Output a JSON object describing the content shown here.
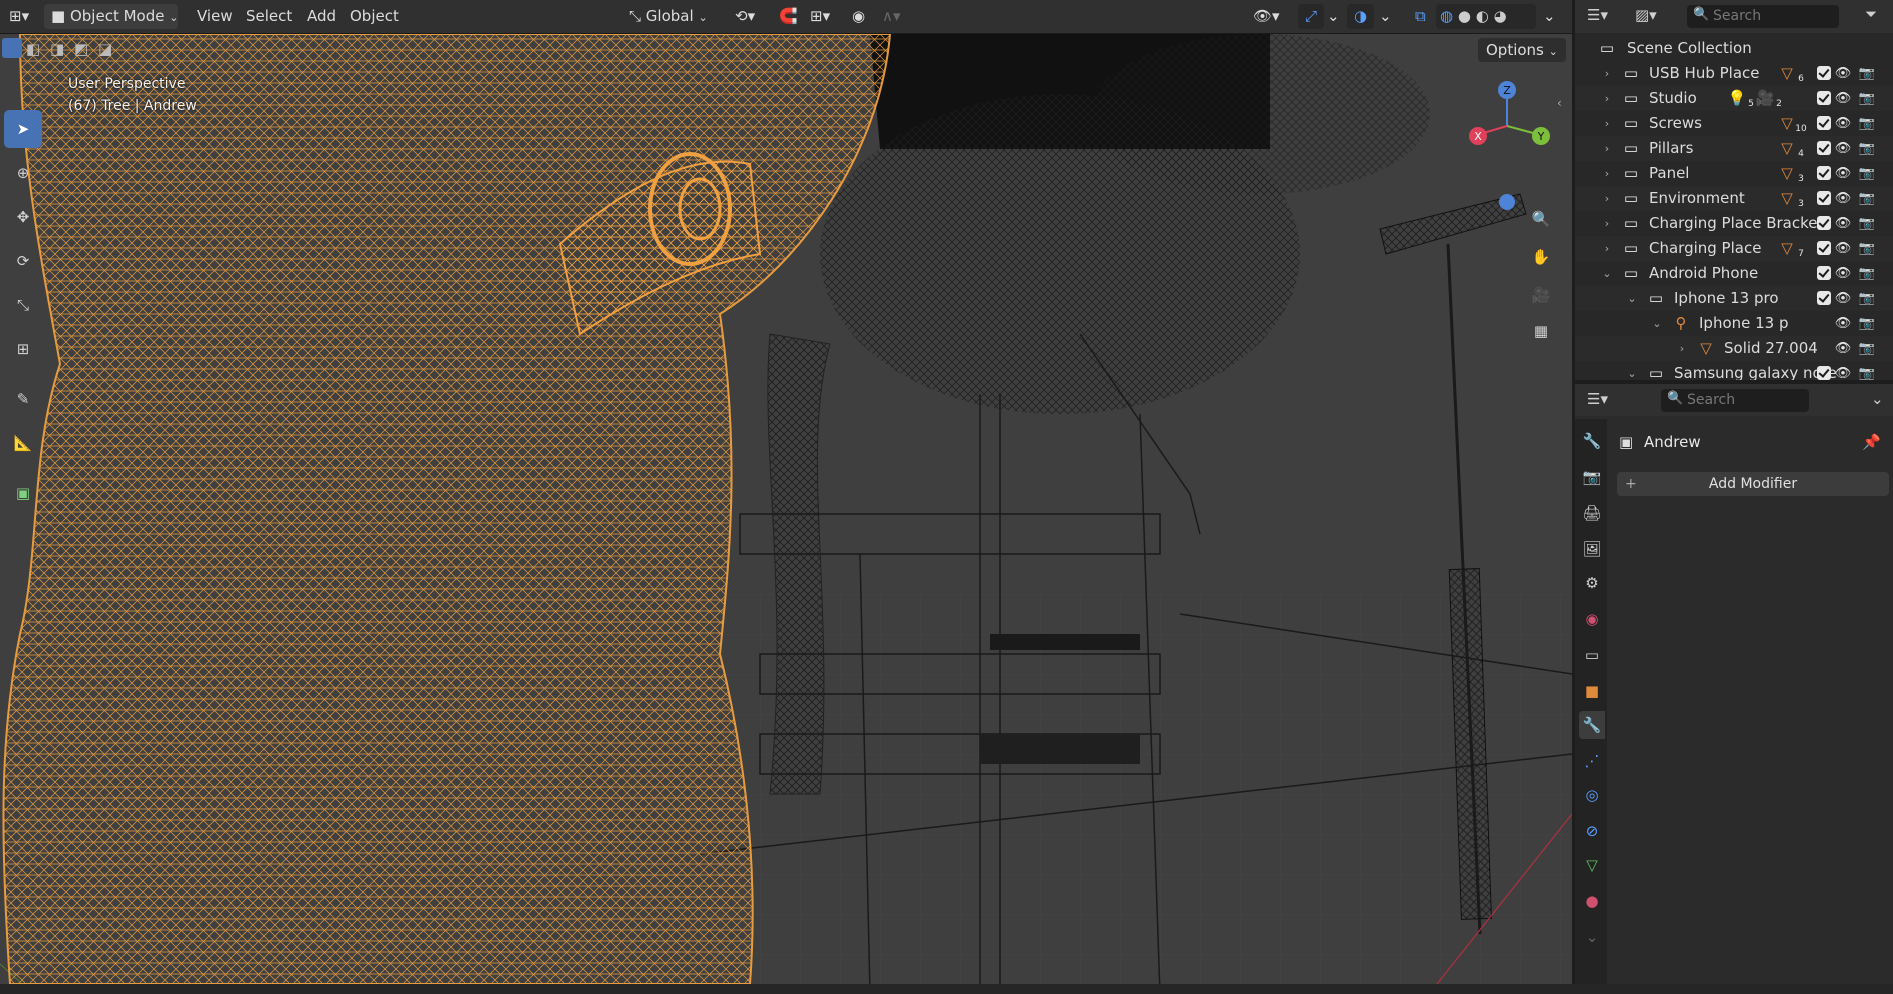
{
  "header": {
    "mode": "Object Mode",
    "menus": [
      "View",
      "Select",
      "Add",
      "Object"
    ],
    "orientation": "Global",
    "options_label": "Options"
  },
  "viewport": {
    "perspective_label": "User Perspective",
    "object_info": "(67) Tree | Andrew",
    "gizmo_axes": {
      "x": "X",
      "y": "Y",
      "z": "Z"
    },
    "colors": {
      "selected_wire": "#f0a040",
      "background": "#3f3f3f",
      "wire": "#1a1a1a"
    }
  },
  "outliner": {
    "search_placeholder": "Search",
    "root": "Scene Collection",
    "rows": [
      {
        "name": "USB Hub Place",
        "badge_icon": "mesh-icon",
        "badge_count": "6"
      },
      {
        "name": "Studio",
        "badge_icon": "light-icon",
        "badge_count": "5",
        "badge2_icon": "camera-icon",
        "badge2_count": "2"
      },
      {
        "name": "Screws",
        "badge_icon": "mesh-icon",
        "badge_count": "10"
      },
      {
        "name": "Pillars",
        "badge_icon": "mesh-icon",
        "badge_count": "4"
      },
      {
        "name": "Panel",
        "badge_icon": "mesh-icon",
        "badge_count": "3"
      },
      {
        "name": "Environment",
        "badge_icon": "mesh-icon",
        "badge_count": "3"
      },
      {
        "name": "Charging Place Bracket"
      },
      {
        "name": "Charging Place",
        "badge_icon": "mesh-icon",
        "badge_count": "7"
      },
      {
        "name": "Android Phone"
      },
      {
        "name": "Iphone 13 pro"
      },
      {
        "name": "Iphone 13 p"
      },
      {
        "name": "Solid 27.004"
      },
      {
        "name": "Samsung galaxy note"
      }
    ]
  },
  "properties": {
    "search_placeholder": "Search",
    "object_name": "Andrew",
    "add_modifier_label": "Add Modifier"
  }
}
